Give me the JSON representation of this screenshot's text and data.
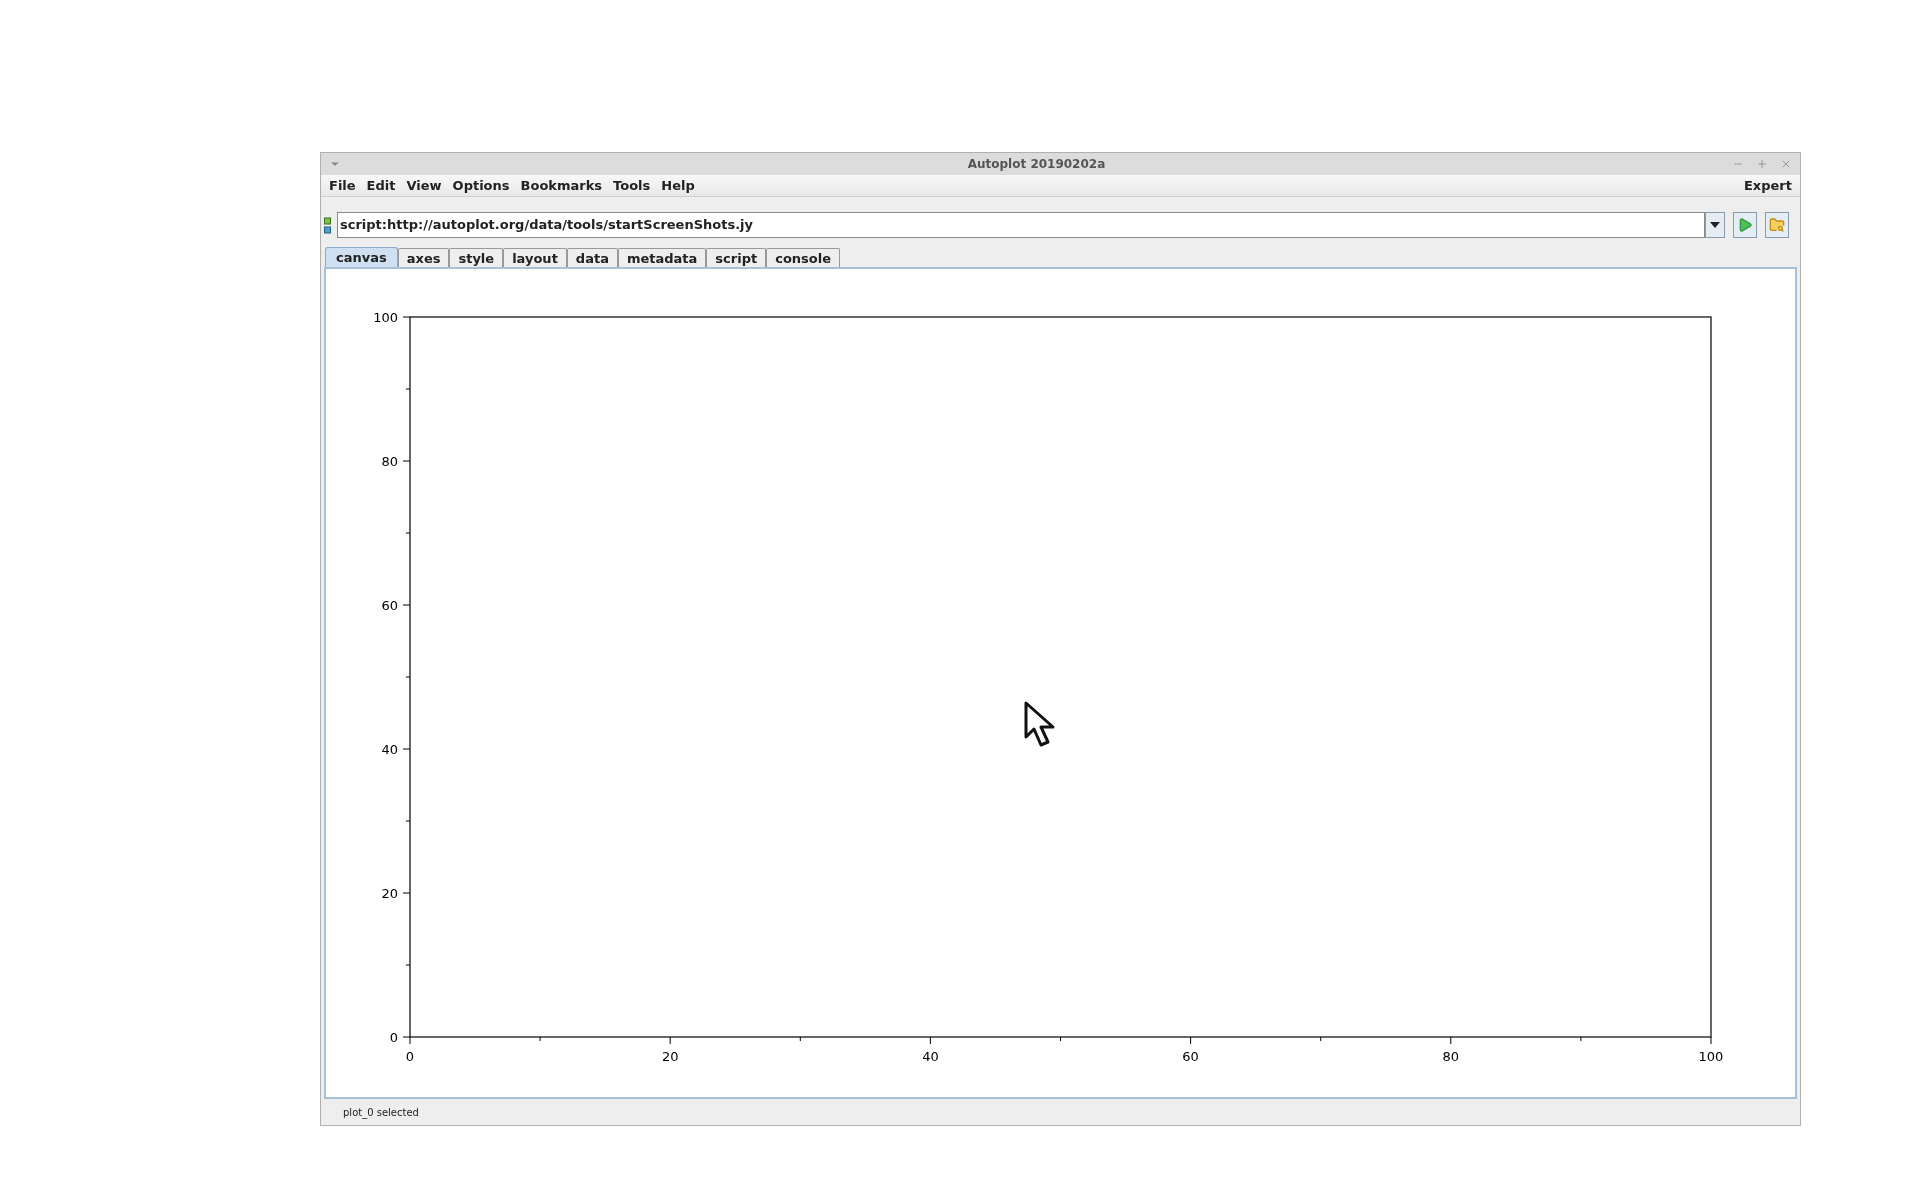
{
  "window": {
    "title": "Autoplot 20190202a"
  },
  "menu": [
    "File",
    "Edit",
    "View",
    "Options",
    "Bookmarks",
    "Tools",
    "Help"
  ],
  "menu_right": "Expert",
  "address": {
    "value": "script:http://autoplot.org/data/tools/startScreenShots.jy"
  },
  "tabs": [
    {
      "label": "canvas",
      "selected": true
    },
    {
      "label": "axes",
      "selected": false
    },
    {
      "label": "style",
      "selected": false
    },
    {
      "label": "layout",
      "selected": false
    },
    {
      "label": "data",
      "selected": false
    },
    {
      "label": "metadata",
      "selected": false
    },
    {
      "label": "script",
      "selected": false
    },
    {
      "label": "console",
      "selected": false
    }
  ],
  "canvas": {
    "chart_data": {
      "type": "line",
      "xlim": [
        0,
        100
      ],
      "ylim": [
        0,
        100
      ],
      "xticks": [
        0,
        20,
        40,
        60,
        80,
        100
      ],
      "yticks": [
        0,
        20,
        40,
        60,
        80,
        100
      ]
    }
  },
  "status_bar": "plot_0 selected"
}
